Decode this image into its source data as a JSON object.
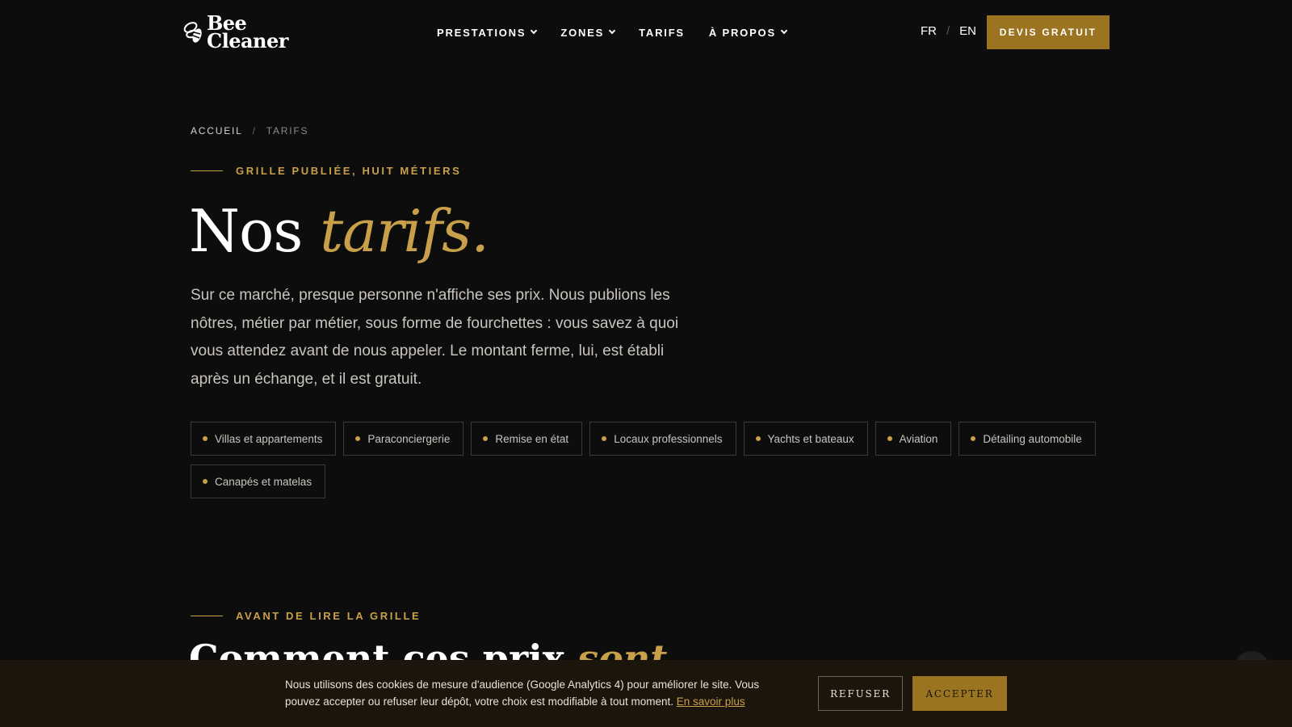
{
  "brand": {
    "logo_line1": "Bee",
    "logo_line2": "Cleaner"
  },
  "nav": {
    "items": [
      {
        "label": "PRESTATIONS",
        "has_dropdown": true
      },
      {
        "label": "ZONES",
        "has_dropdown": true
      },
      {
        "label": "TARIFS",
        "has_dropdown": false
      },
      {
        "label": "À PROPOS",
        "has_dropdown": true
      }
    ]
  },
  "lang": {
    "fr": "FR",
    "en": "EN"
  },
  "cta_label": "DEVIS GRATUIT",
  "breadcrumb": {
    "home": "ACCUEIL",
    "sep": "/",
    "current": "TARIFS"
  },
  "hero": {
    "eyebrow": "GRILLE PUBLIÉE, HUIT MÉTIERS",
    "title_plain": "Nos ",
    "title_accent": "tarifs.",
    "intro": "Sur ce marché, presque personne n'affiche ses prix. Nous publions les nôtres, métier par métier, sous forme de fourchettes : vous savez à quoi vous attendez avant de nous appeler. Le montant ferme, lui, est établi après un échange, et il est gratuit.",
    "tags": [
      "Villas et appartements",
      "Paraconciergerie",
      "Remise en état",
      "Locaux professionnels",
      "Yachts et bateaux",
      "Aviation",
      "Détailing automobile",
      "Canapés et matelas"
    ]
  },
  "section2": {
    "eyebrow": "AVANT DE LIRE LA GRILLE",
    "title_plain": "Comment ces prix ",
    "title_accent": "sont"
  },
  "cookie": {
    "text": "Nous utilisons des cookies de mesure d'audience (Google Analytics 4) pour améliorer le site. Vous pouvez accepter ou refuser leur dépôt, votre choix est modifiable à tout moment.",
    "link": "En savoir plus",
    "refuse": "REFUSER",
    "accept": "ACCEPTER"
  },
  "colors": {
    "gold": "#c9a04a",
    "button_gold": "#9a7421",
    "background": "#0d0d0d",
    "cookie_bg": "#1b150c"
  }
}
